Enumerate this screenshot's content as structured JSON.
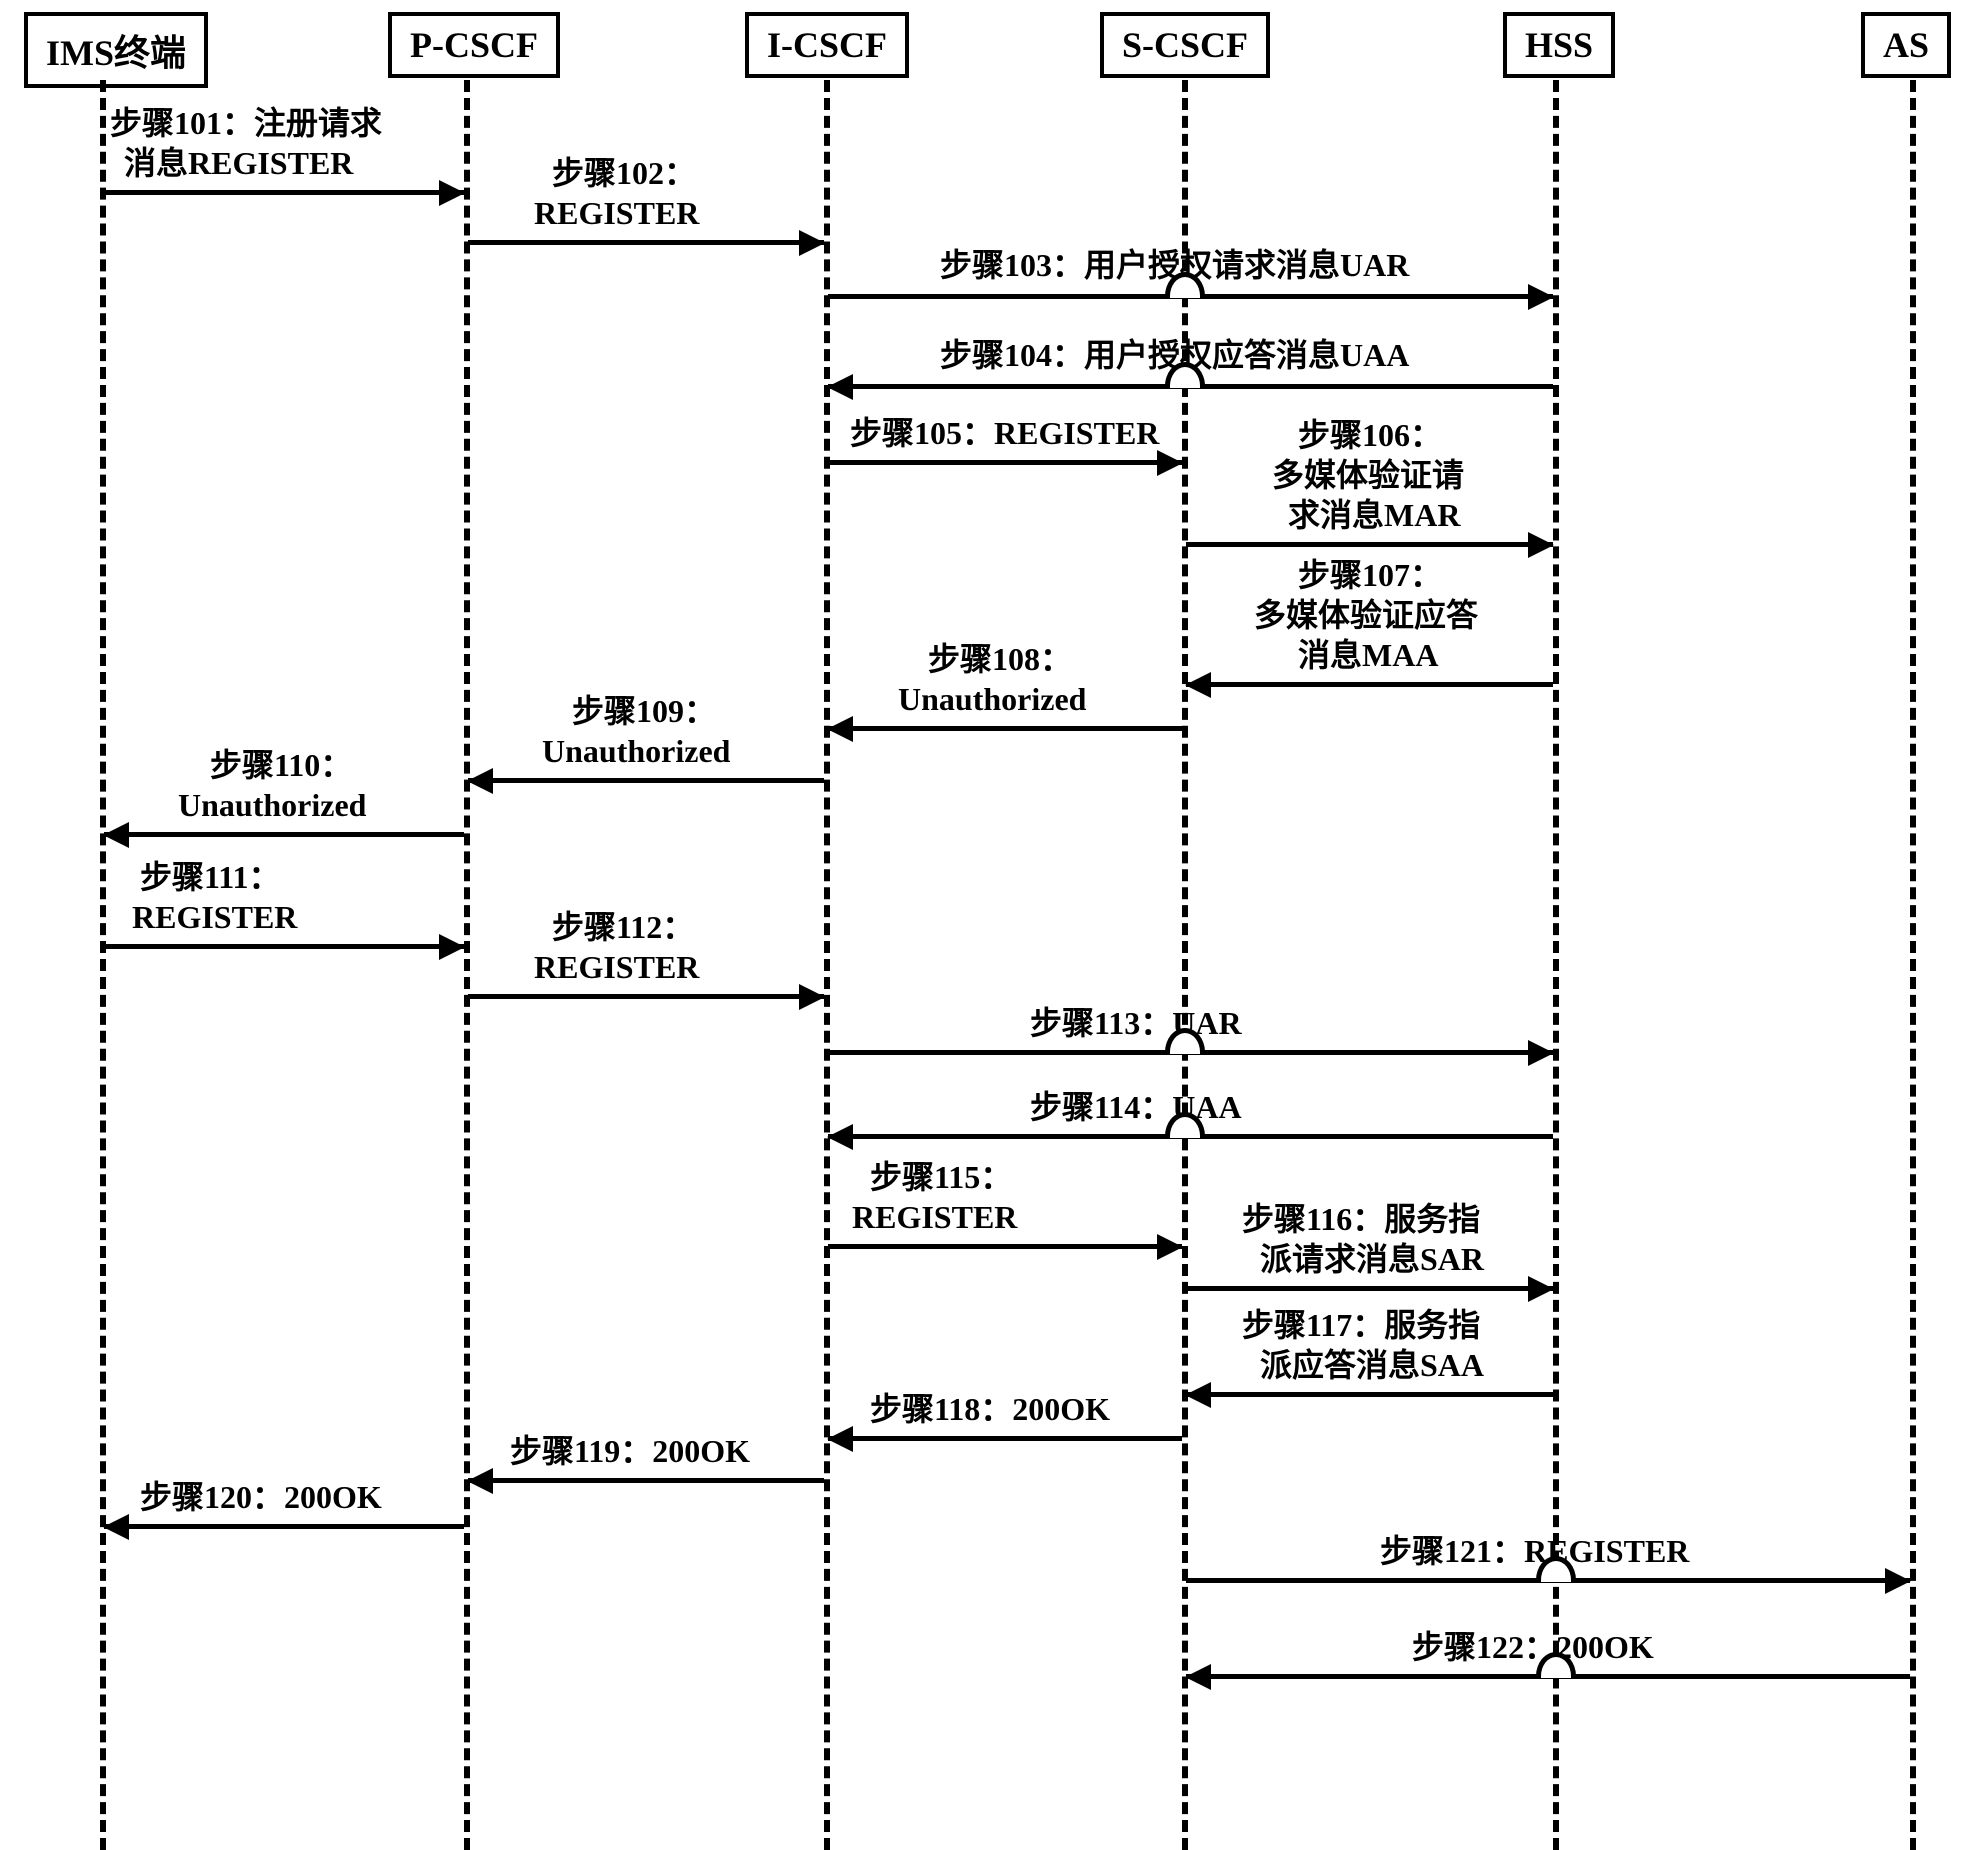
{
  "participants": {
    "p0": "IMS终端",
    "p1": "P-CSCF",
    "p2": "I-CSCF",
    "p3": "S-CSCF",
    "p4": "HSS",
    "p5": "AS"
  },
  "messages": {
    "m101a": "步骤101：注册请求",
    "m101b": "消息REGISTER",
    "m102a": "步骤102：",
    "m102b": "REGISTER",
    "m103": "步骤103：用户授权请求消息UAR",
    "m104": "步骤104：用户授权应答消息UAA",
    "m105": "步骤105：REGISTER",
    "m106a": "步骤106：",
    "m106b": "多媒体验证请",
    "m106c": "求消息MAR",
    "m107a": "步骤107：",
    "m107b": "多媒体验证应答",
    "m107c": "消息MAA",
    "m108a": "步骤108：",
    "m108b": "Unauthorized",
    "m109a": "步骤109：",
    "m109b": "Unauthorized",
    "m110a": "步骤110：",
    "m110b": "Unauthorized",
    "m111a": "步骤111：",
    "m111b": "REGISTER",
    "m112a": "步骤112：",
    "m112b": "REGISTER",
    "m113": "步骤113：UAR",
    "m114": "步骤114：UAA",
    "m115a": "步骤115：",
    "m115b": "REGISTER",
    "m116a": "步骤116：服务指",
    "m116b": "派请求消息SAR",
    "m117a": "步骤117：服务指",
    "m117b": "派应答消息SAA",
    "m118": "步骤118：200OK",
    "m119": "步骤119：200OK",
    "m120": "步骤120：200OK",
    "m121": "步骤121：REGISTER",
    "m122": "步骤122：200OK"
  }
}
